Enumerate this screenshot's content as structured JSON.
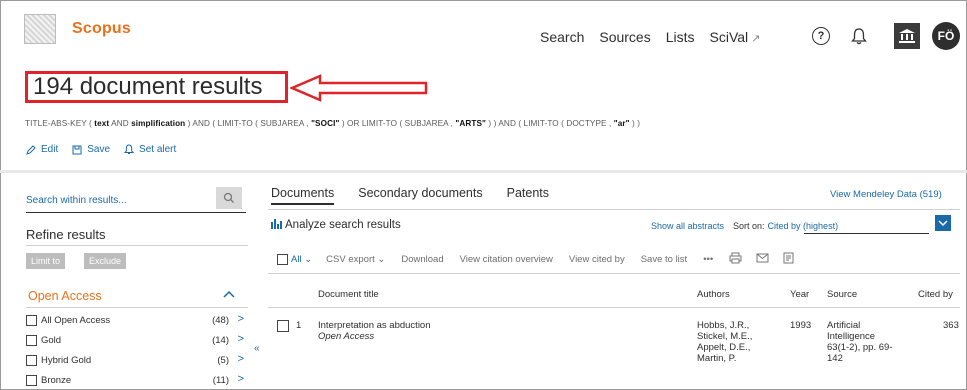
{
  "header": {
    "brand": "Scopus",
    "nav": [
      "Search",
      "Sources",
      "Lists",
      "SciVal"
    ],
    "nav_external_marker": "↗",
    "help_icon": "?",
    "avatar_initials": "FÖ"
  },
  "results": {
    "title": "194 document results",
    "highlight_color": "#e0232b",
    "query_parts": [
      {
        "t": "TITLE-ABS-KEY ( ",
        "b": false
      },
      {
        "t": "text",
        "b": true
      },
      {
        "t": " AND ",
        "b": false
      },
      {
        "t": "simplification",
        "b": true
      },
      {
        "t": " ) AND ( LIMIT-TO ( SUBJAREA , ",
        "b": false
      },
      {
        "t": "\"SOCI\"",
        "b": true
      },
      {
        "t": " ) OR LIMIT-TO ( SUBJAREA , ",
        "b": false
      },
      {
        "t": "\"ARTS\"",
        "b": true
      },
      {
        "t": " ) ) AND ( LIMIT-TO ( DOCTYPE , ",
        "b": false
      },
      {
        "t": "\"ar\"",
        "b": true
      },
      {
        "t": " ) )",
        "b": false
      }
    ],
    "actions": [
      "Edit",
      "Save",
      "Set alert"
    ]
  },
  "left": {
    "search_placeholder": "Search within results...",
    "refine_title": "Refine results",
    "limit_to": "Limit to",
    "exclude": "Exclude",
    "open_access_title": "Open Access",
    "facets": [
      {
        "label": "All Open Access",
        "count": "(48)"
      },
      {
        "label": "Gold",
        "count": "(14)"
      },
      {
        "label": "Hybrid Gold",
        "count": "(5)"
      },
      {
        "label": "Bronze",
        "count": "(11)"
      }
    ]
  },
  "main": {
    "tabs": [
      "Documents",
      "Secondary documents",
      "Patents"
    ],
    "mendeley": "View Mendeley Data (519)",
    "analyze": "Analyze search results",
    "show_abstracts": "Show all abstracts",
    "sort_label": "Sort on:",
    "sort_value": "Cited by (highest)",
    "toolbar": {
      "all": "All",
      "csv_export": "CSV export",
      "download": "Download",
      "view_citation_overview": "View citation overview",
      "view_cited_by": "View cited by",
      "save_to_list": "Save to list",
      "more": "•••"
    },
    "columns": [
      "Document title",
      "Authors",
      "Year",
      "Source",
      "Cited by"
    ],
    "rows": [
      {
        "num": "1",
        "title": "Interpretation as abduction",
        "access": "Open Access",
        "authors": [
          "Hobbs, J.R.,",
          "Stickel, M.E.,",
          "Appelt, D.E.,",
          "Martin, P."
        ],
        "year": "1993",
        "source": [
          "Artificial",
          "Intelligence",
          "63(1-2), pp. 69-",
          "142"
        ],
        "cited_by": "363"
      }
    ]
  },
  "colors": {
    "brand_orange": "#e9711c",
    "link_blue": "#1a6aaa"
  }
}
